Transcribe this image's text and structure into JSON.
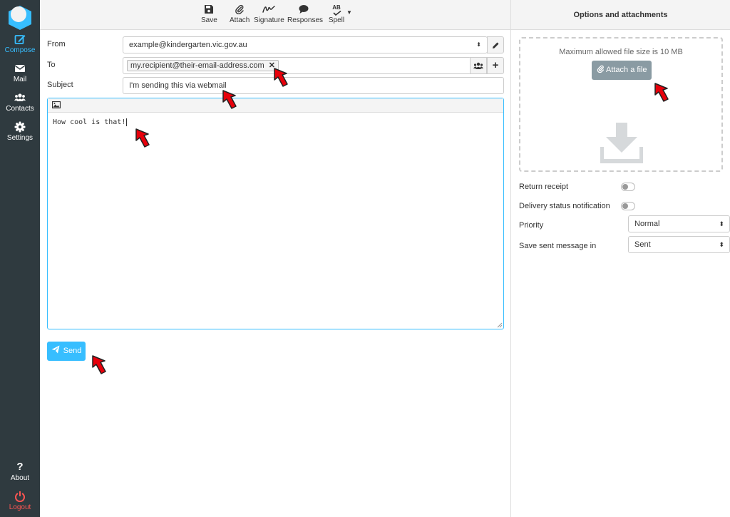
{
  "nav": {
    "items": [
      {
        "label": "Compose",
        "icon": "compose-icon",
        "active": true
      },
      {
        "label": "Mail",
        "icon": "mail-icon"
      },
      {
        "label": "Contacts",
        "icon": "contacts-icon"
      },
      {
        "label": "Settings",
        "icon": "gear-icon"
      }
    ],
    "about": "About",
    "logout": "Logout"
  },
  "toolbar": {
    "save": "Save",
    "attach": "Attach",
    "signature": "Signature",
    "responses": "Responses",
    "spell": "Spell",
    "spell_icon_text": "AB"
  },
  "form": {
    "from_label": "From",
    "from_value": "example@kindergarten.vic.gov.au",
    "to_label": "To",
    "to_recipient": "my.recipient@their-email-address.com",
    "subject_label": "Subject",
    "subject_value": "I'm sending this via webmail",
    "body": "How cool is that!",
    "send": "Send"
  },
  "options": {
    "title": "Options and attachments",
    "max_size": "Maximum allowed file size is 10 MB",
    "attach_file": "Attach a file",
    "return_receipt": "Return receipt",
    "delivery_status": "Delivery status notification",
    "priority_label": "Priority",
    "priority_value": "Normal",
    "save_sent_label": "Save sent message in",
    "save_sent_value": "Sent"
  },
  "colors": {
    "accent": "#37beff",
    "nav_bg": "#2f3a3f",
    "logout": "#ff5552",
    "annotation_arrow": "#e8000b"
  }
}
